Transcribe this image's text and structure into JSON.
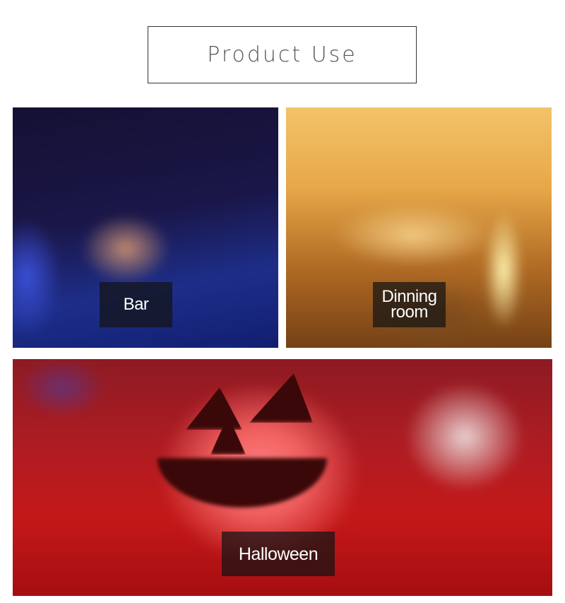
{
  "header": {
    "title": "Product Use"
  },
  "scenes": [
    {
      "key": "bar",
      "label": "Bar",
      "depicts": "bar-scene"
    },
    {
      "key": "dining",
      "label_line1": "Dinning",
      "label_line2": "room",
      "depicts": "dining-room-scene"
    },
    {
      "key": "halloween",
      "label": "Halloween",
      "depicts": "halloween-pumpkin-scene"
    }
  ],
  "colors": {
    "bar_tone": "#1d2e8a",
    "dining_tone": "#e7a848",
    "halloween_tone": "#c41818",
    "label_bg": "#141414"
  }
}
